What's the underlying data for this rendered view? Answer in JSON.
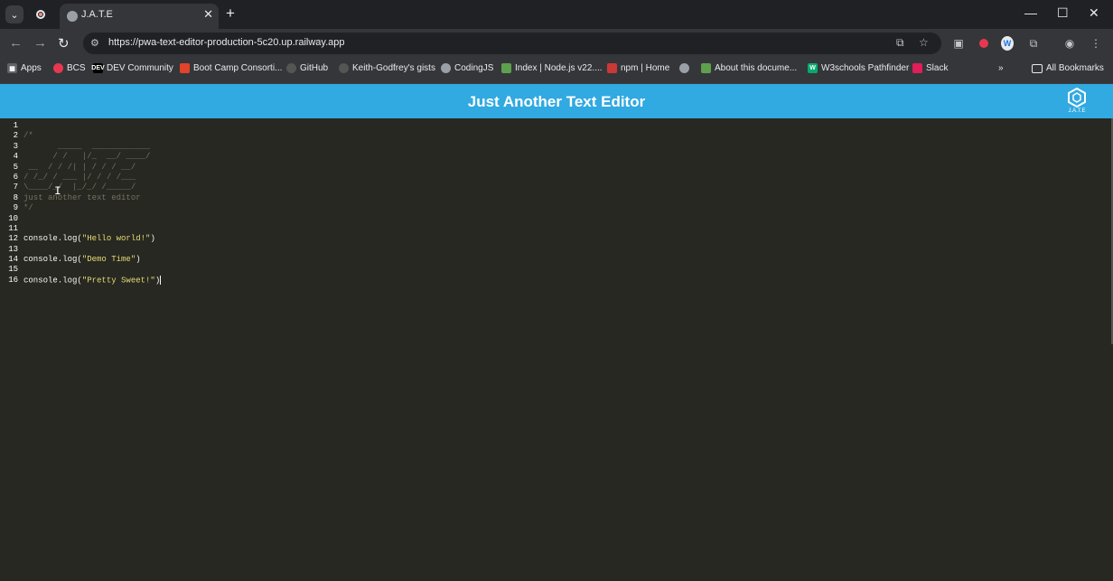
{
  "browser": {
    "tab_title": "J.A.T.E",
    "url": "https://pwa-text-editor-production-5c20.up.railway.app"
  },
  "bookmarks": [
    {
      "label": "Apps",
      "icon": "apps-grid-icon",
      "color": "#e8eaed"
    },
    {
      "label": "BCS",
      "icon": "bcs-icon",
      "color": "#e8384f"
    },
    {
      "label": "DEV Community",
      "icon": "dev-icon",
      "color": "#000000"
    },
    {
      "label": "Boot Camp Consorti...",
      "icon": "gitlab-icon",
      "color": "#e24329"
    },
    {
      "label": "GitHub",
      "icon": "github-icon",
      "color": "#555555"
    },
    {
      "label": "Keith-Godfrey's gists",
      "icon": "github-icon",
      "color": "#555555"
    },
    {
      "label": "CodingJS",
      "icon": "globe-icon",
      "color": "#9aa0a6"
    },
    {
      "label": "Index | Node.js v22....",
      "icon": "nodejs-icon",
      "color": "#5fa04e"
    },
    {
      "label": "npm | Home",
      "icon": "npm-icon",
      "color": "#cb3837"
    },
    {
      "label": "",
      "icon": "globe-icon",
      "color": "#9aa0a6"
    },
    {
      "label": "About this docume...",
      "icon": "nodejs-icon",
      "color": "#5fa04e"
    },
    {
      "label": "W3schools Pathfinder",
      "icon": "w3schools-icon",
      "color": "#04aa6d"
    },
    {
      "label": "Slack",
      "icon": "slack-icon",
      "color": "#e01e5a"
    }
  ],
  "all_bookmarks_label": "All Bookmarks",
  "app": {
    "title": "Just Another Text Editor",
    "logo_text": "J.A.T.E"
  },
  "editor": {
    "line_numbers": [
      "1",
      "2",
      "3",
      "4",
      "5",
      "6",
      "7",
      "8",
      "9",
      "10",
      "11",
      "12",
      "13",
      "14",
      "15",
      "16"
    ],
    "lines": [
      {
        "comment": ""
      },
      {
        "comment": "/*"
      },
      {
        "comment": "       _____  ____________"
      },
      {
        "comment": "      / /   |/_  __/ ____/"
      },
      {
        "comment": " __  / / /| | / / / __/"
      },
      {
        "comment": "/ /_/ / ___ |/ / / /___"
      },
      {
        "comment": "\\____/_/  |_/_/ /_____/"
      },
      {
        "comment": "just another text editor"
      },
      {
        "comment": "*/"
      },
      {
        "comment": ""
      },
      {
        "comment": ""
      },
      {
        "ident": "console.log(",
        "str": "\"Hello world!\"",
        "tail": ")"
      },
      {
        "comment": ""
      },
      {
        "ident": "console.log(",
        "str": "\"Demo Time\"",
        "tail": ")"
      },
      {
        "comment": ""
      },
      {
        "ident": "console.log(",
        "str": "\"Pretty Sweet!\"",
        "tail": ")"
      }
    ]
  },
  "colors": {
    "header": "#31a9e1",
    "editor_bg": "#272822",
    "comment": "#75715e",
    "string": "#e6db74"
  }
}
